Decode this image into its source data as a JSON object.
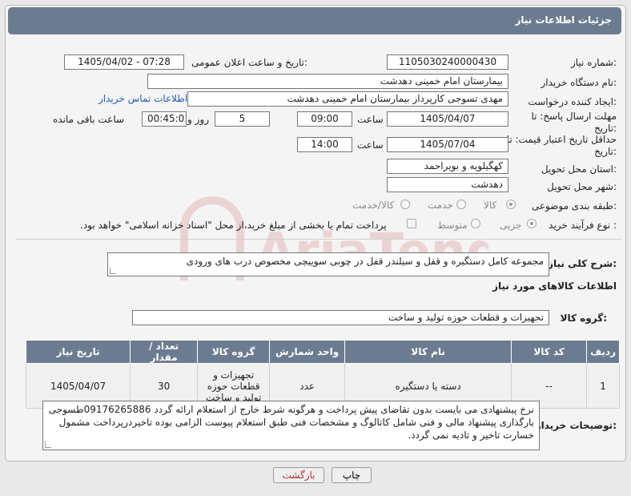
{
  "header": {
    "title": "جزئیات اطلاعات نیاز"
  },
  "fields": {
    "need_number_label": "شماره نیاز:",
    "need_number": "1105030240000430",
    "announce_label": "تاریخ و ساعت اعلان عمومی:",
    "announce_value": "1405/04/02 - 07:28",
    "buyer_org_label": "نام دستگاه خریدار:",
    "buyer_org": "بیمارستان امام خمینی دهدشت",
    "requester_label": "ایجاد کننده درخواست:",
    "requester": "مهدی تسوجی کارپرداز بیمارستان امام خمینی دهدشت",
    "contact_link": "اطلاعات تماس خریدار",
    "deadline_label": "مهلت ارسال پاسخ: تا تاریخ:",
    "deadline_date": "1405/04/07",
    "time_label": "ساعت",
    "deadline_time": "09:00",
    "days_value": "5",
    "days_label": "روز و",
    "remaining_time": "00:45:01",
    "remaining_label": "ساعت باقی مانده",
    "validity_label": "حداقل تاریخ اعتبار قیمت: تا تاریخ:",
    "validity_date": "1405/07/04",
    "validity_time": "14:00",
    "province_label": "استان محل تحویل:",
    "province": "کهگیلویه و بویراحمد",
    "city_label": "شهر محل تحویل:",
    "city": "دهدشت",
    "category_label": "طبقه بندی موضوعی:",
    "category_options": [
      "کالا",
      "خدمت",
      "کالا/خدمت"
    ],
    "process_label": "نوع فرآیند خرید :",
    "process_options": [
      "جزیی",
      "متوسط"
    ],
    "payment_note": "پرداخت تمام یا بخشی از مبلغ خرید،از محل \"اسناد خزانه اسلامی\" خواهد بود.",
    "summary_label": "شرح کلی نیاز:",
    "summary": "مجموعه کامل دستگیره و قفل و سیلندر قفل در چوبی سوییچی مخصوص درب های ورودی",
    "goods_info_title": "اطلاعات کالاهای مورد نیاز",
    "goods_group_label": "گروه کالا:",
    "goods_group": "تجهیزات و قطعات حوزه تولید و ساخت"
  },
  "table": {
    "headers": [
      "ردیف",
      "کد کالا",
      "نام کالا",
      "واحد شمارش",
      "گروه کالا",
      "تعداد / مقدار",
      "تاریخ نیاز"
    ],
    "rows": [
      [
        "1",
        "--",
        "دسته یا دستگیره",
        "عدد",
        "تجهیزات و قطعات حوزه تولید و ساخت",
        "30",
        "1405/04/07"
      ]
    ]
  },
  "buyer_notes_label": "توضیحات خریدار:",
  "buyer_notes": "نرخ پیشنهادی می بایست بدون تقاضای پیش پرداخت و هرگونه شرط خارج از استعلام ارائه گردد 09176265886طسوجی بارگذاری پیشنهاد مالی و فنی شامل کاتالوگ و مشخصات فنی طبق استعلام پیوست الزامی بوده تاخیردرپرداخت مشمول خسارت تاخیر و تادیه نمی گردد.",
  "buttons": {
    "print": "چاپ",
    "back": "بازگشت"
  },
  "watermark_text": "AriaTender.net",
  "colors": {
    "header_bg": "#6c7c90",
    "link": "#1e5fb3",
    "back_text": "#b03030"
  }
}
